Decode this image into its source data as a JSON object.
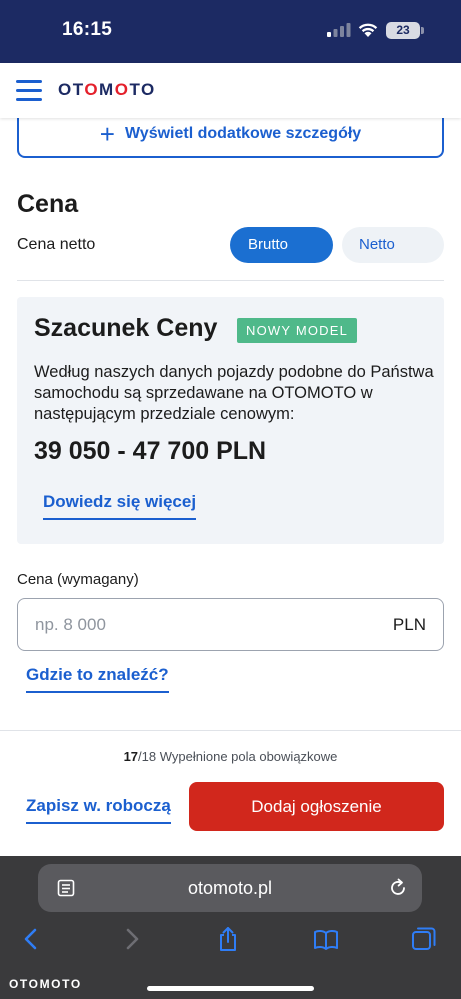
{
  "status_bar": {
    "time": "16:15",
    "battery": "23"
  },
  "header": {
    "logo_prefix": "OT",
    "logo_o1": "O",
    "logo_mid": "M",
    "logo_o2": "O",
    "logo_suffix": "TO"
  },
  "details_button": {
    "label": "Wyświetl dodatkowe szczegóły"
  },
  "price_section": {
    "title": "Cena",
    "net_label": "Cena netto",
    "toggle_options": [
      "Brutto",
      "Netto"
    ],
    "selected_toggle": "Brutto"
  },
  "estimate": {
    "title": "Szacunek Ceny",
    "badge": "NOWY MODEL",
    "description": "Według naszych danych pojazdy podobne do Państwa samochodu są sprzedawane na OTOMOTO w następującym przedziale cenowym:",
    "range": "39 050 - 47 700 PLN",
    "link": "Dowiedz się więcej"
  },
  "price_input": {
    "label": "Cena (wymagany)",
    "placeholder": "np. 8 000",
    "value": "",
    "unit": "PLN",
    "help_link": "Gdzie to znaleźć?"
  },
  "bottom_bar": {
    "filled": "17",
    "total": "/18",
    "progress_suffix": " Wypełnione pola obowiązkowe",
    "draft_link": "Zapisz w. roboczą",
    "submit_button": "Dodaj ogłoszenie"
  },
  "browser": {
    "url": "otomoto.pl",
    "watermark": "OTOMOTO"
  },
  "colors": {
    "brand_blue": "#1b5fcf",
    "brand_red": "#d1271c",
    "badge_green": "#4fb98a",
    "status_bar": "#1c2a63"
  }
}
